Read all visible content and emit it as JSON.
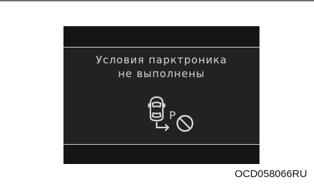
{
  "display": {
    "message_line1": "Условия парктроника",
    "message_line2": "не выполнены",
    "icon": "parking-assist-unavailable-icon",
    "icon_letter": "P"
  },
  "caption": "OCD058066RU",
  "colors": {
    "screen_background": "#222222",
    "bar_background": "#151515",
    "text": "#d6d6d6"
  }
}
